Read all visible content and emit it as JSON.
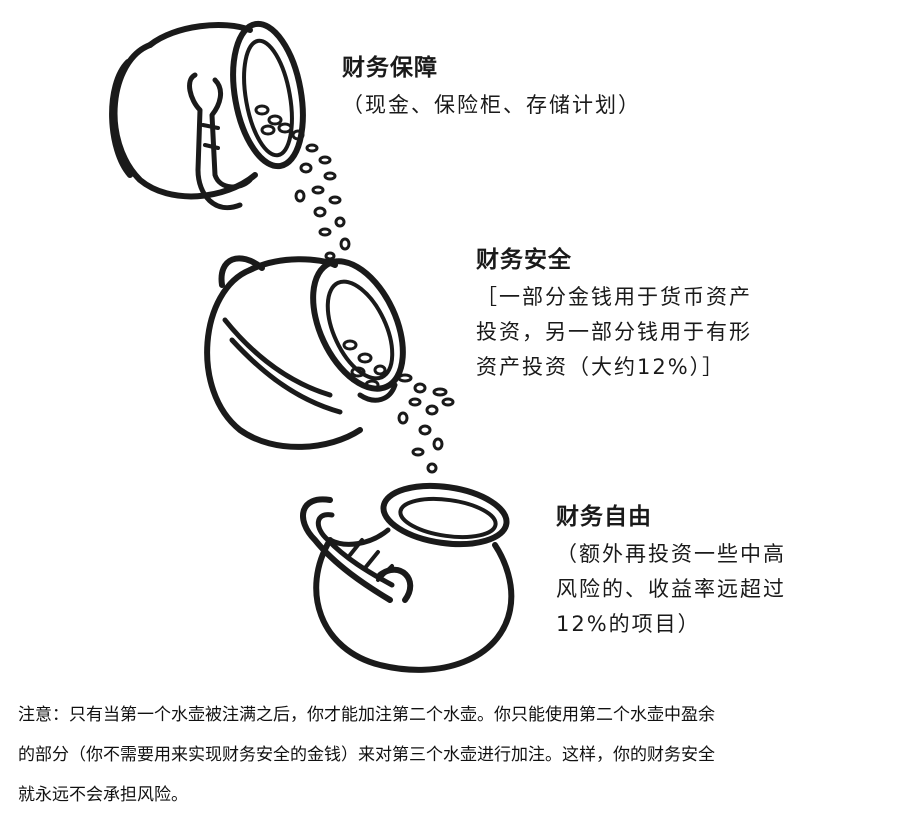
{
  "jugs": [
    {
      "title": "财务保障",
      "lines": [
        "（现金、保险柜、存储计划）"
      ]
    },
    {
      "title": "财务安全",
      "lines": [
        "［一部分金钱用于货币资产",
        "投资，另一部分钱用于有形",
        "资产投资（大约12%）］"
      ]
    },
    {
      "title": "财务自由",
      "lines": [
        "（额外再投资一些中高",
        "风险的、收益率远超过",
        "12%的项目）"
      ]
    }
  ],
  "note": {
    "lines": [
      "注意：只有当第一个水壶被注满之后，你才能加注第二个水壶。你只能使用第二个水壶中盈余",
      "的部分（你不需要用来实现财务安全的金钱）来对第三个水壶进行加注。这样，你的财务安全",
      "就永远不会承担风险。"
    ]
  },
  "colors": {
    "ink": "#1a1a1a",
    "background": "#ffffff"
  }
}
